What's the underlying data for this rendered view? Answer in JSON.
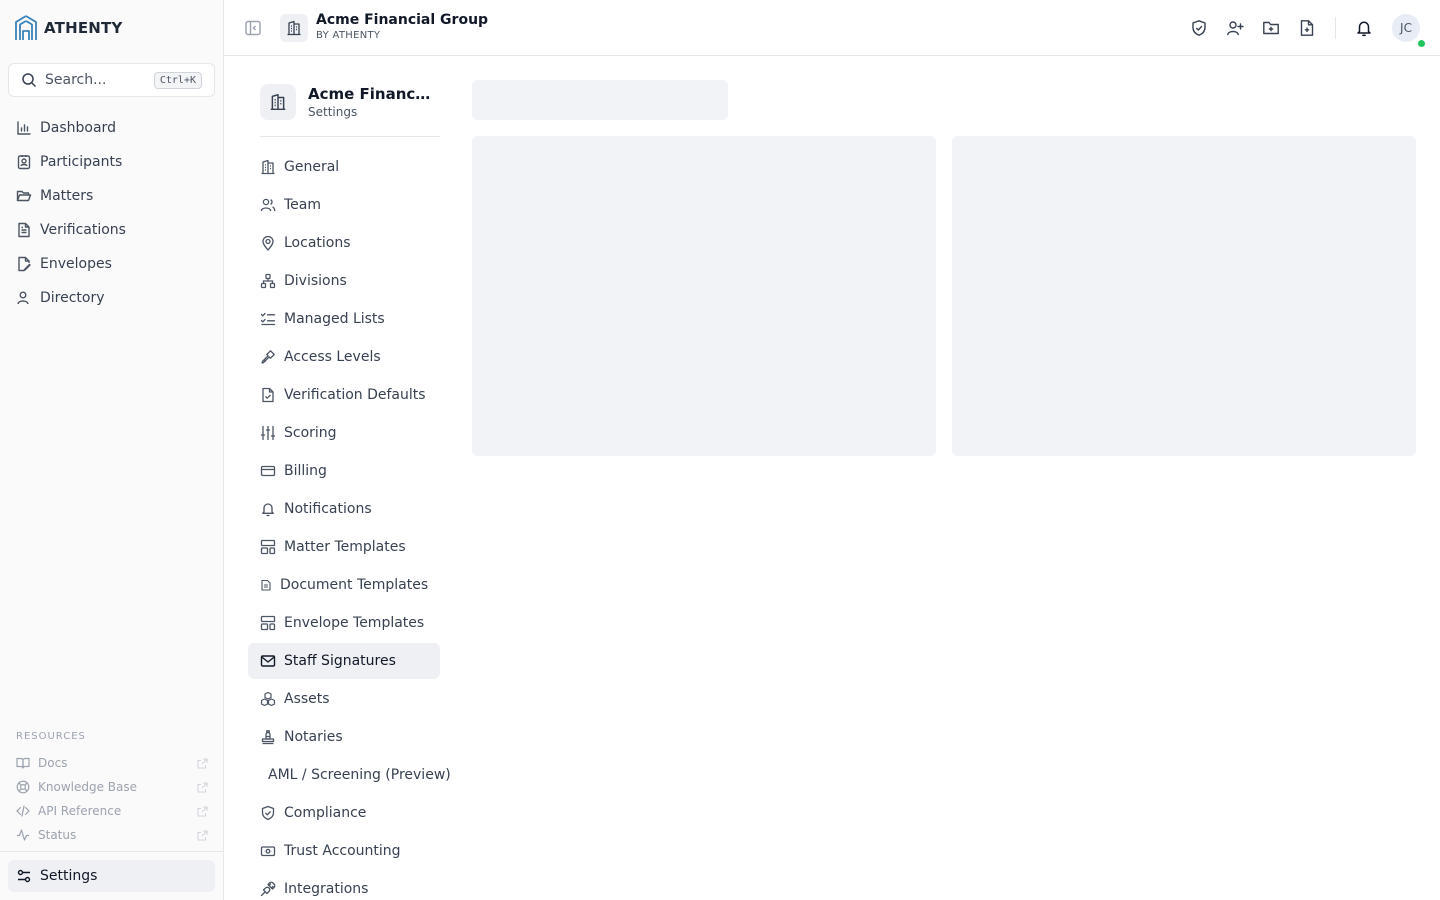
{
  "brand": {
    "name": "ATHENTY"
  },
  "search": {
    "placeholder": "Search...",
    "shortcut": "Ctrl+K"
  },
  "nav": {
    "items": [
      {
        "label": "Dashboard",
        "icon": "bar-chart-icon"
      },
      {
        "label": "Participants",
        "icon": "contact-card-icon"
      },
      {
        "label": "Matters",
        "icon": "folder-open-icon"
      },
      {
        "label": "Verifications",
        "icon": "document-text-icon"
      },
      {
        "label": "Envelopes",
        "icon": "file-pen-icon"
      },
      {
        "label": "Directory",
        "icon": "users-icon"
      }
    ]
  },
  "resources": {
    "heading": "RESOURCES",
    "items": [
      {
        "label": "Docs",
        "icon": "book-open-icon"
      },
      {
        "label": "Knowledge Base",
        "icon": "life-buoy-icon"
      },
      {
        "label": "API Reference",
        "icon": "code-icon"
      },
      {
        "label": "Status",
        "icon": "activity-icon"
      }
    ]
  },
  "sidebar_footer": {
    "settings_label": "Settings"
  },
  "topbar": {
    "org_name": "Acme Financial Group",
    "org_sub": "BY ATHENTY",
    "user_initials": "JC"
  },
  "settings_nav": {
    "title": "Acme Financial Group",
    "subtitle": "Settings",
    "active_index": 13,
    "items": [
      {
        "label": "General",
        "icon": "building-icon"
      },
      {
        "label": "Team",
        "icon": "users-icon"
      },
      {
        "label": "Locations",
        "icon": "map-pin-icon"
      },
      {
        "label": "Divisions",
        "icon": "network-icon"
      },
      {
        "label": "Managed Lists",
        "icon": "list-checks-icon"
      },
      {
        "label": "Access Levels",
        "icon": "key-icon"
      },
      {
        "label": "Verification Defaults",
        "icon": "file-check-icon"
      },
      {
        "label": "Scoring",
        "icon": "sliders-icon"
      },
      {
        "label": "Billing",
        "icon": "credit-card-icon"
      },
      {
        "label": "Notifications",
        "icon": "bell-icon"
      },
      {
        "label": "Matter Templates",
        "icon": "layout-template-icon"
      },
      {
        "label": "Document Templates",
        "icon": "small-document-icon"
      },
      {
        "label": "Envelope Templates",
        "icon": "layout-template-icon"
      },
      {
        "label": "Staff Signatures",
        "icon": "mail-icon"
      },
      {
        "label": "Assets",
        "icon": "boxes-icon"
      },
      {
        "label": "Notaries",
        "icon": "stamp-icon"
      },
      {
        "label": "AML / Screening (Preview)",
        "icon": ""
      },
      {
        "label": "Compliance",
        "icon": "shield-check-icon"
      },
      {
        "label": "Trust Accounting",
        "icon": "banknote-icon"
      },
      {
        "label": "Integrations",
        "icon": "plug-icon"
      }
    ]
  }
}
